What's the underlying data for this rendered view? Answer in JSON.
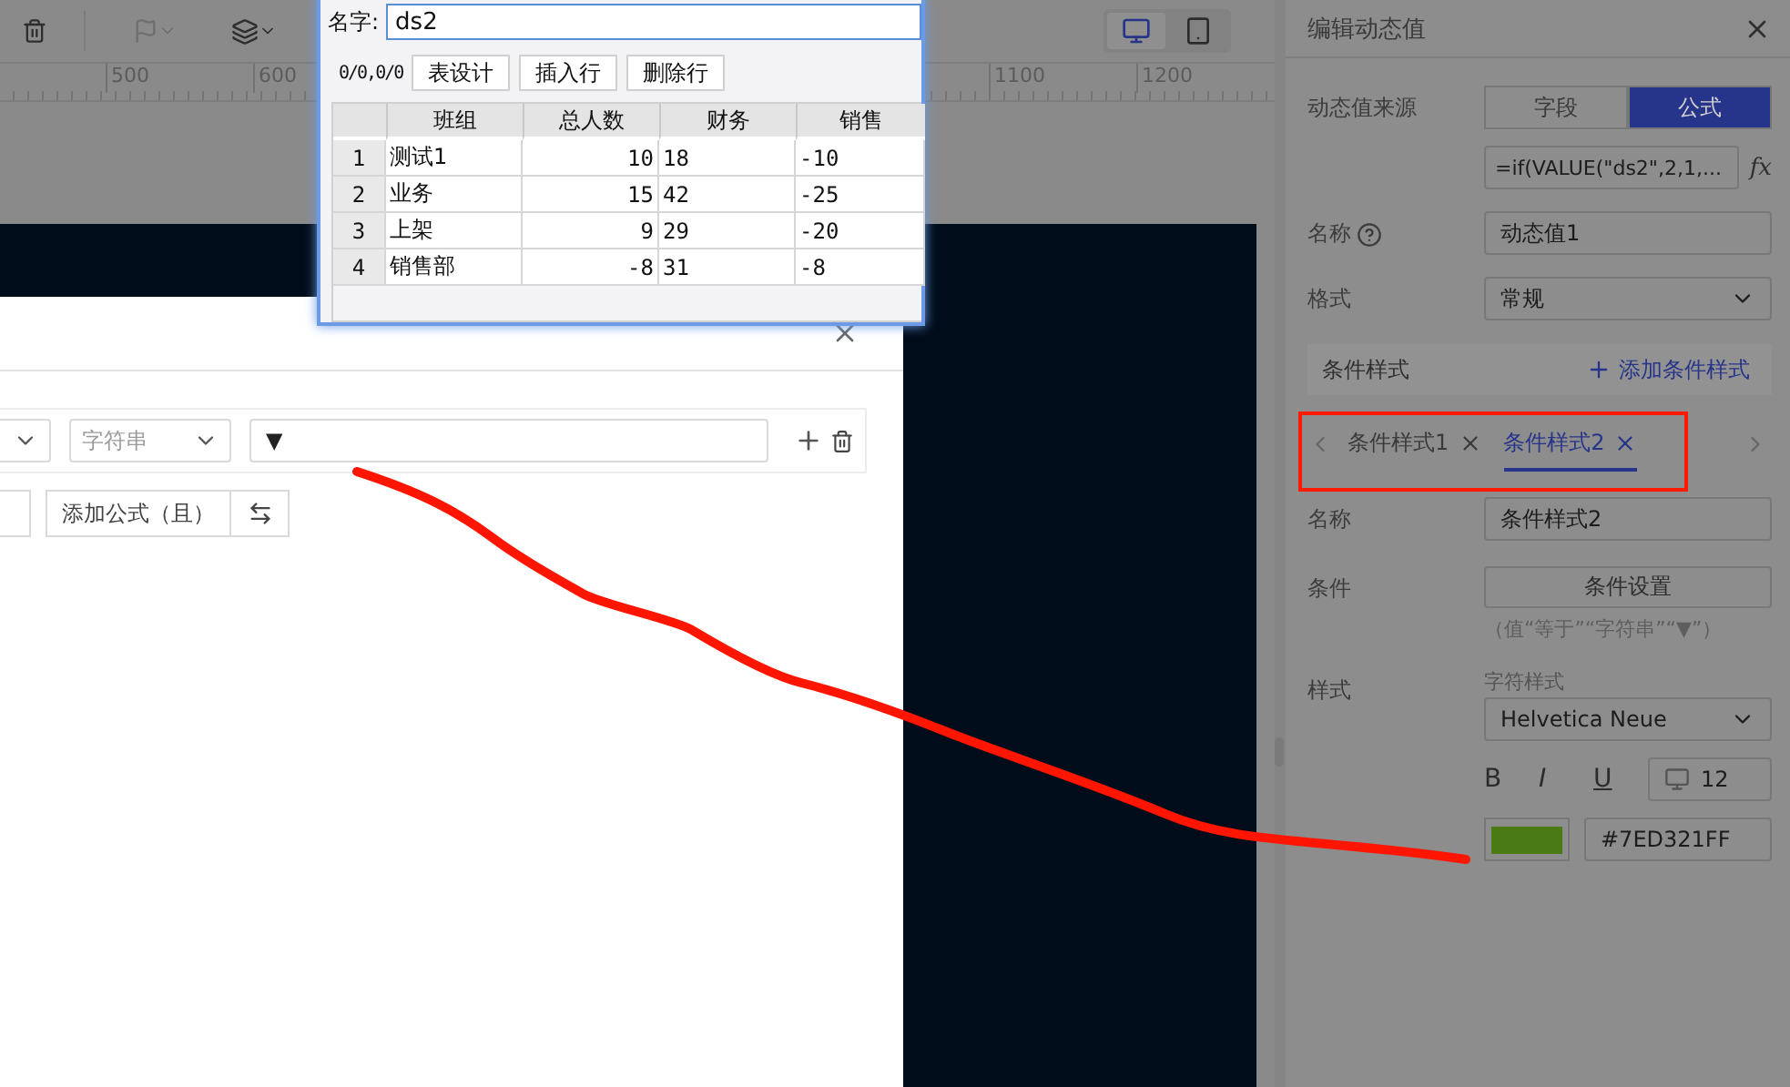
{
  "toolbar": {
    "device_buttons": [
      {
        "kind": "desktop",
        "selected": true
      },
      {
        "kind": "tablet",
        "selected": false
      }
    ]
  },
  "ruler": {
    "left_marks": [
      "500",
      "600"
    ],
    "right_marks": [
      "1100",
      "1200"
    ]
  },
  "condition_dialog": {
    "type_select": "字符串",
    "value": "▼",
    "add_formula": "添加公式（且）"
  },
  "dataset_window": {
    "name_label": "名字:",
    "name_value": "ds2",
    "position": "0/0,0/0",
    "buttons": [
      "表设计",
      "插入行",
      "删除行"
    ],
    "table": {
      "columns": [
        "班组",
        "总人数",
        "财务",
        "销售"
      ],
      "rows": [
        {
          "index": "1",
          "cells": [
            "测试1",
            "10",
            "18",
            "-10"
          ]
        },
        {
          "index": "2",
          "cells": [
            "业务",
            "15",
            "42",
            "-25"
          ]
        },
        {
          "index": "3",
          "cells": [
            "上架",
            "9",
            "29",
            "-20"
          ]
        },
        {
          "index": "4",
          "cells": [
            "销售部",
            "-8",
            "31",
            "-8"
          ]
        }
      ]
    }
  },
  "panel": {
    "title": "编辑动态值",
    "source": {
      "label": "动态值来源",
      "options": [
        {
          "label": "字段",
          "selected": false
        },
        {
          "label": "公式",
          "selected": true
        }
      ],
      "formula": "=if(VALUE(\"ds2\",2,1,...",
      "fx": "fx"
    },
    "name": {
      "label": "名称",
      "value": "动态值1"
    },
    "format": {
      "label": "格式",
      "value": "常规"
    },
    "conditional": {
      "title": "条件样式",
      "add": "添加条件样式",
      "tabs": [
        {
          "label": "条件样式1",
          "selected": false
        },
        {
          "label": "条件样式2",
          "selected": true
        }
      ]
    },
    "style_name": {
      "label": "名称",
      "value": "条件样式2"
    },
    "condition": {
      "label": "条件",
      "button": "条件设置",
      "hint": "（值“等于”“字符串”“▼”）"
    },
    "style": {
      "label": "样式",
      "sublabel": "字符样式",
      "font": "Helvetica Neue",
      "bold": "B",
      "italic": "I",
      "underline": "U",
      "font_size": "12",
      "hex": "#7ED321FF"
    }
  }
}
